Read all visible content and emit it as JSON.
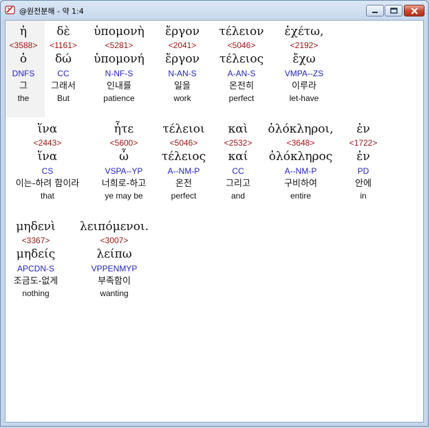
{
  "window": {
    "title": "@원전분해 - 약 1:4"
  },
  "rows": [
    [
      {
        "greek": "ἡ",
        "strong": "<3588>",
        "lemma": "ὁ",
        "parse": "DNFS",
        "korean": "그",
        "english": "the"
      },
      {
        "greek": "δὲ",
        "strong": "<1161>",
        "lemma": "δώ",
        "parse": "CC",
        "korean": "그래서",
        "english": "But"
      },
      {
        "greek": "ὑπομονὴ",
        "strong": "<5281>",
        "lemma": "ὑπομονή",
        "parse": "N-NF-S",
        "korean": "인내를",
        "english": "patience"
      },
      {
        "greek": "ἔργον",
        "strong": "<2041>",
        "lemma": "ἔργον",
        "parse": "N-AN-S",
        "korean": "일을",
        "english": "work"
      },
      {
        "greek": "τέλειον",
        "strong": "<5046>",
        "lemma": "τέλειος",
        "parse": "A-AN-S",
        "korean": "온전히",
        "english": "perfect"
      },
      {
        "greek": "ἐχέτω,",
        "strong": "<2192>",
        "lemma": "ἔχω",
        "parse": "VMPA--ZS",
        "korean": "이루라",
        "english": "let-have"
      }
    ],
    [
      {
        "greek": "ἵνα",
        "strong": "<2443>",
        "lemma": "ἵνα",
        "parse": "CS",
        "korean": "이는-하려 함이라",
        "english": "that"
      },
      {
        "greek": "ἦτε",
        "strong": "<5600>",
        "lemma": "ὦ",
        "parse": "VSPA--YP",
        "korean": "너희로-하고",
        "english": "ye may be"
      },
      {
        "greek": "τέλειοι",
        "strong": "<5046>",
        "lemma": "τέλειος",
        "parse": "A--NM-P",
        "korean": "온전",
        "english": "perfect"
      },
      {
        "greek": "καὶ",
        "strong": "<2532>",
        "lemma": "καί",
        "parse": "CC",
        "korean": "그리고",
        "english": "and"
      },
      {
        "greek": "ὁλόκληροι,",
        "strong": "<3648>",
        "lemma": "ὁλόκληρος",
        "parse": "A--NM-P",
        "korean": "구비하여",
        "english": "entire"
      },
      {
        "greek": "ἐν",
        "strong": "<1722>",
        "lemma": "ἐν",
        "parse": "PD",
        "korean": "안에",
        "english": "in"
      }
    ],
    [
      {
        "greek": "μηδενὶ",
        "strong": "<3367>",
        "lemma": "μηδείς",
        "parse": "APCDN-S",
        "korean": "조금도-없게",
        "english": "nothing"
      },
      {
        "greek": "λειπόμενοι.",
        "strong": "<3007>",
        "lemma": "λείπω",
        "parse": "VPPENMYP",
        "korean": "부족함이",
        "english": "wanting"
      }
    ]
  ]
}
